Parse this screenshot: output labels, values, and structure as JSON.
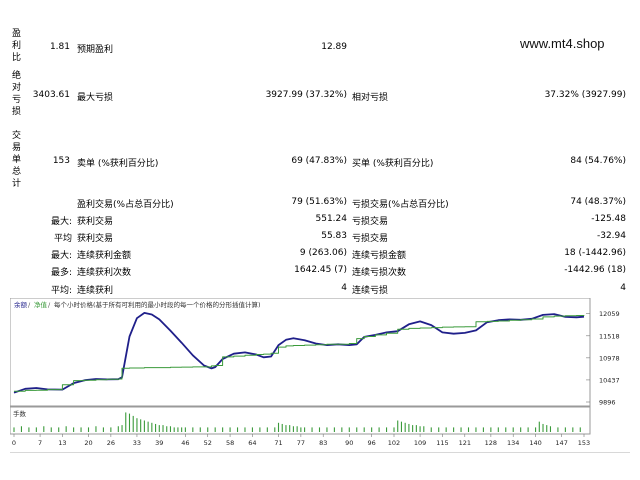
{
  "watermark": "www.mt4.shop",
  "side_labels": {
    "profit_ratio": "盈利比",
    "absolute_loss": "绝对亏损",
    "total_trades": "交易单总计"
  },
  "rows": {
    "r1": {
      "v1": "1.81",
      "l2": "预期盈利",
      "v2": "12.89"
    },
    "r2": {
      "v1": "3403.61",
      "l2": "最大亏损",
      "v2": "3927.99 (37.32%)",
      "l3": "相对亏损",
      "v3": "37.32% (3927.99)"
    },
    "r3": {
      "v1": "153",
      "l2": "卖单 (%获利百分比)",
      "v2": "69 (47.83%)",
      "l3": "买单 (%获利百分比)",
      "v3": "84 (54.76%)"
    },
    "r4": {
      "l2": "盈利交易(%占总百分比)",
      "v2": "79 (51.63%)",
      "l3": "亏损交易(%占总百分比)",
      "v3": "74 (48.37%)"
    },
    "r5": {
      "p": "最大:",
      "l2": "获利交易",
      "v2": "551.24",
      "l3": "亏损交易",
      "v3": "-125.48"
    },
    "r6": {
      "p": "平均",
      "l2": "获利交易",
      "v2": "55.83",
      "l3": "亏损交易",
      "v3": "-32.94"
    },
    "r7": {
      "p": "最大:",
      "l2": "连续获利金额",
      "v2": "9 (263.06)",
      "l3": "连续亏损金额",
      "v3": "18 (-1442.96)"
    },
    "r8": {
      "p": "最多:",
      "l2": "连续获利次数",
      "v2": "1642.45 (7)",
      "l3": "连续亏损次数",
      "v3": "-1442.96 (18)"
    },
    "r9": {
      "p": "平均:",
      "l2": "连续获利",
      "v2": "4",
      "l3": "连续亏损",
      "v3": "4"
    }
  },
  "chart_data": {
    "type": "line",
    "legend": [
      "余额",
      "净值",
      "每个小时价格(基于所有可利用的最小时段的每一个价格的分形插值计算)"
    ],
    "volume_label": "手数",
    "x_ticks": [
      0,
      7,
      13,
      20,
      26,
      33,
      39,
      46,
      52,
      58,
      64,
      71,
      77,
      83,
      90,
      96,
      102,
      109,
      115,
      121,
      128,
      134,
      140,
      147,
      153
    ],
    "y_ticks": [
      12059,
      11518,
      10978,
      10437,
      9896
    ],
    "xlim": [
      0,
      153
    ],
    "ylim": [
      9896,
      12150
    ],
    "series": [
      {
        "name": "余额",
        "color": "#1f1f8a",
        "x": [
          0,
          3,
          6,
          9,
          13,
          16,
          19,
          22,
          25,
          28,
          29,
          31,
          33,
          35,
          37,
          39,
          42,
          45,
          48,
          51,
          53,
          54,
          56,
          59,
          62,
          65,
          67,
          69,
          71,
          73,
          75,
          78,
          81,
          84,
          87,
          90,
          92,
          94,
          97,
          100,
          103,
          106,
          109,
          112,
          115,
          118,
          121,
          124,
          127,
          130,
          133,
          136,
          139,
          142,
          145,
          148,
          151,
          153
        ],
        "y": [
          10125,
          10220,
          10240,
          10205,
          10200,
          10360,
          10430,
          10460,
          10450,
          10455,
          10500,
          11500,
          11950,
          12080,
          12040,
          11920,
          11640,
          11350,
          11040,
          10790,
          10720,
          10750,
          10950,
          11080,
          11110,
          11060,
          10990,
          11010,
          11290,
          11420,
          11460,
          11410,
          11330,
          11290,
          11310,
          11290,
          11310,
          11490,
          11540,
          11600,
          11630,
          11800,
          11870,
          11780,
          11600,
          11570,
          11590,
          11650,
          11850,
          11900,
          11920,
          11910,
          11935,
          12030,
          12050,
          11980,
          11970,
          11985
        ]
      },
      {
        "name": "净值",
        "color": "#3a9a3a",
        "x": [
          0,
          3,
          6,
          9,
          13,
          16,
          19,
          22,
          25,
          28,
          29,
          31,
          33,
          35,
          37,
          39,
          42,
          45,
          48,
          51,
          53,
          54,
          56,
          59,
          62,
          65,
          67,
          69,
          71,
          73,
          75,
          78,
          81,
          84,
          87,
          90,
          92,
          94,
          97,
          100,
          103,
          106,
          109,
          112,
          115,
          118,
          121,
          124,
          127,
          130,
          133,
          136,
          139,
          142,
          145,
          148,
          151,
          153
        ],
        "y": [
          10160,
          10180,
          10185,
          10200,
          10320,
          10420,
          10430,
          10440,
          10455,
          10460,
          10725,
          10730,
          10730,
          10740,
          10740,
          10740,
          10745,
          10750,
          10755,
          10755,
          10780,
          10790,
          11000,
          11020,
          11040,
          11060,
          11070,
          11090,
          11240,
          11270,
          11280,
          11290,
          11300,
          11310,
          11310,
          11330,
          11450,
          11500,
          11540,
          11580,
          11680,
          11700,
          11710,
          11720,
          11730,
          11735,
          11740,
          11860,
          11870,
          11880,
          11900,
          11910,
          11930,
          11980,
          12000,
          12010,
          12015,
          12020
        ]
      }
    ],
    "volume": {
      "x": [
        0,
        2,
        4,
        6,
        8,
        10,
        12,
        14,
        16,
        18,
        20,
        22,
        24,
        26,
        28,
        29,
        30,
        31,
        32,
        33,
        34,
        35,
        36,
        37,
        38,
        39,
        40,
        41,
        42,
        43,
        44,
        45,
        46,
        48,
        50,
        52,
        54,
        56,
        58,
        60,
        62,
        64,
        66,
        68,
        70,
        71,
        72,
        73,
        74,
        75,
        76,
        77,
        78,
        80,
        82,
        84,
        86,
        88,
        90,
        92,
        94,
        96,
        98,
        100,
        102,
        103,
        104,
        105,
        106,
        107,
        108,
        109,
        110,
        112,
        114,
        116,
        118,
        120,
        122,
        124,
        126,
        128,
        130,
        132,
        134,
        136,
        138,
        140,
        141,
        142,
        143,
        144,
        146,
        148,
        150,
        152
      ],
      "v": [
        0.2,
        0.25,
        0.2,
        0.2,
        0.25,
        0.2,
        0.2,
        0.25,
        0.2,
        0.2,
        0.2,
        0.25,
        0.2,
        0.2,
        0.25,
        0.3,
        0.85,
        0.8,
        0.7,
        0.6,
        0.55,
        0.5,
        0.45,
        0.4,
        0.35,
        0.3,
        0.3,
        0.25,
        0.25,
        0.2,
        0.2,
        0.2,
        0.2,
        0.2,
        0.2,
        0.2,
        0.2,
        0.2,
        0.2,
        0.2,
        0.2,
        0.2,
        0.2,
        0.2,
        0.2,
        0.4,
        0.35,
        0.3,
        0.3,
        0.25,
        0.25,
        0.2,
        0.2,
        0.2,
        0.2,
        0.2,
        0.2,
        0.2,
        0.2,
        0.2,
        0.2,
        0.2,
        0.2,
        0.2,
        0.2,
        0.5,
        0.45,
        0.4,
        0.35,
        0.3,
        0.3,
        0.25,
        0.25,
        0.2,
        0.2,
        0.2,
        0.2,
        0.2,
        0.2,
        0.2,
        0.2,
        0.2,
        0.2,
        0.2,
        0.2,
        0.2,
        0.2,
        0.2,
        0.45,
        0.35,
        0.3,
        0.25,
        0.2,
        0.2,
        0.2,
        0.2
      ]
    }
  }
}
